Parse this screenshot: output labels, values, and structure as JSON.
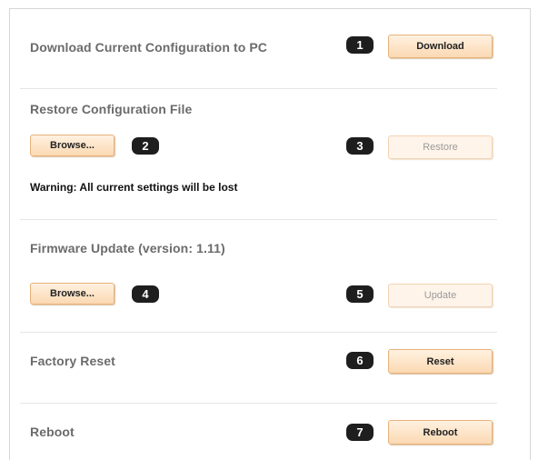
{
  "sections": {
    "download": {
      "title": "Download Current Configuration to PC",
      "badge": "1",
      "button": "Download"
    },
    "restore": {
      "title": "Restore Configuration File",
      "browse_button": "Browse...",
      "browse_badge": "2",
      "restore_badge": "3",
      "restore_button": "Restore",
      "warning": "Warning: All current settings will be lost"
    },
    "firmware": {
      "title": "Firmware Update (version: 1.11)",
      "browse_button": "Browse...",
      "browse_badge": "4",
      "update_badge": "5",
      "update_button": "Update"
    },
    "factory_reset": {
      "title": "Factory Reset",
      "badge": "6",
      "button": "Reset"
    },
    "reboot": {
      "title": "Reboot",
      "badge": "7",
      "button": "Reboot"
    }
  },
  "colors": {
    "button_fill": "#fbd9b3",
    "button_border": "#e8b27a",
    "badge": "#1e1e1e",
    "heading": "#6b6b6b"
  }
}
